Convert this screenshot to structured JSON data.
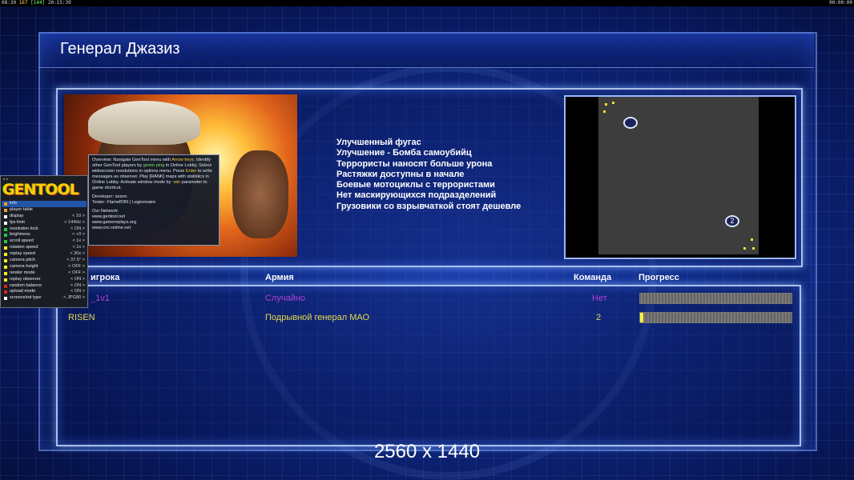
{
  "status_bar": {
    "left_a": "08:30",
    "left_fps": "167",
    "left_b": "[144]",
    "left_time": "20:15:39",
    "right": "00:00:00"
  },
  "screen": {
    "title": "Генерал Джазиз",
    "resolution_label": "2560 x 1440"
  },
  "upgrades": [
    "Улучшенный фугас",
    "Улучшение - Бомба самоубийц",
    "Террористы наносят больше урона",
    "Растяжки доступны в начале",
    "Боевые мотоциклы с террористами",
    "Нет маскирующихся подразделений",
    "Грузовики со взрывчаткой стоят дешевле"
  ],
  "minimap": {
    "start_1": "",
    "start_2": "2"
  },
  "players_table": {
    "headers": {
      "name": "игрока",
      "army": "Армия",
      "team": "Команда",
      "progress": "Прогресс"
    },
    "rows": [
      {
        "name": "_1v1",
        "army": "Случайно",
        "team": "Нет",
        "progress": 0.0,
        "color": "#b040d0"
      },
      {
        "name": "RISEN",
        "army": "Подрывной генерал МАО",
        "team": "2",
        "progress": 0.02,
        "color": "#e8d84a"
      }
    ]
  },
  "tooltip": {
    "p1a": "Overview: Navigate GenTool menu with ",
    "p1b": "Arrow keys",
    "p1c": ". Identify other GenTool players by ",
    "p1d": "green ping",
    "p1e": " in Online Lobby. Select widescreen resolutions in options menu. Press ",
    "p1f": "Enter",
    "p1g": " to write messages as observer. Play [RANK] maps with statistics in Online Lobby. Activate window mode by ",
    "p1h": "-win",
    "p1i": " parameter to game shortcut.",
    "developer": "Developer: xezon",
    "tester": "Tester: FlamefORI | Legionnaire",
    "network_label": "Our Network:",
    "site1": "www.gentool.net",
    "site2": "www.gamereplays.org",
    "site3": "www.cnc-online.net"
  },
  "gentool": {
    "logo": "GENTOOL",
    "items": [
      {
        "label": "info",
        "value": "",
        "color": "#f0a020",
        "selected": true
      },
      {
        "label": "player table",
        "value": "",
        "color": "#f0a020",
        "selected": false
      },
      {
        "label": "display",
        "value": "< 10 >",
        "color": "#ffffff",
        "selected": false
      },
      {
        "label": "fps limit",
        "value": "< 144Hz >",
        "color": "#ffffff",
        "selected": false
      },
      {
        "label": "resolution lock",
        "value": "< ON >",
        "color": "#22cc44",
        "selected": false
      },
      {
        "label": "brightness",
        "value": "< +3 >",
        "color": "#22cc44",
        "selected": false
      },
      {
        "label": "scroll speed",
        "value": "< 1x >",
        "color": "#22cc44",
        "selected": false
      },
      {
        "label": "rotation speed",
        "value": "< 1x >",
        "color": "#ffee22",
        "selected": false
      },
      {
        "label": "replay speed",
        "value": "< 30x >",
        "color": "#ffee22",
        "selected": false
      },
      {
        "label": "camera pitch",
        "value": "< 37.5° >",
        "color": "#ffee22",
        "selected": false
      },
      {
        "label": "camera height",
        "value": "< OFF >",
        "color": "#ffee22",
        "selected": false
      },
      {
        "label": "render mode",
        "value": "< OFF >",
        "color": "#ffee22",
        "selected": false
      },
      {
        "label": "replay observer",
        "value": "< ON >",
        "color": "#ffee22",
        "selected": false
      },
      {
        "label": "random balance",
        "value": "< ON >",
        "color": "#dd2222",
        "selected": false
      },
      {
        "label": "upload mode",
        "value": "< ON >",
        "color": "#dd2222",
        "selected": false
      },
      {
        "label": "screenshot type",
        "value": "< JPG80 >",
        "color": "#ffffff",
        "selected": false
      }
    ]
  }
}
